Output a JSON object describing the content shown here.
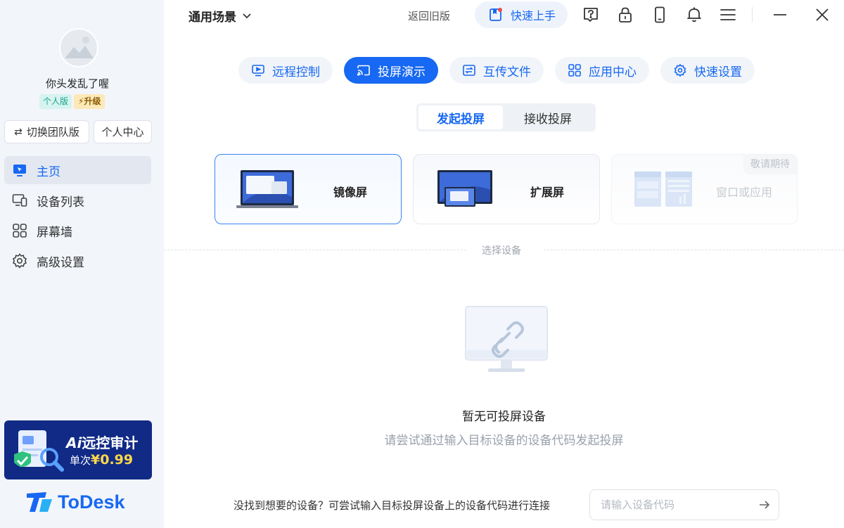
{
  "app": {
    "brand": "ToDesk"
  },
  "user": {
    "name": "你头发乱了喔",
    "edition": "个人版",
    "upgrade": "升级"
  },
  "sidebar": {
    "switch_team": "切换团队版",
    "personal_center": "个人中心",
    "items": [
      {
        "label": "主页",
        "icon": "home-monitor-icon",
        "active": true
      },
      {
        "label": "设备列表",
        "icon": "devices-icon",
        "active": false
      },
      {
        "label": "屏幕墙",
        "icon": "grid-icon",
        "active": false
      },
      {
        "label": "高级设置",
        "icon": "gear-icon",
        "active": false
      }
    ]
  },
  "promo": {
    "ai": "Ai",
    "title": "远控审计",
    "sub": "单次",
    "price": "¥0.99"
  },
  "topbar": {
    "scene": "通用场景",
    "back_old": "返回旧版",
    "quick_start": "快速上手",
    "icons": [
      "help-icon",
      "lock-icon",
      "phone-icon",
      "bell-icon",
      "menu-icon"
    ]
  },
  "main_tabs": [
    {
      "label": "远程控制",
      "icon": "remote-control-icon",
      "active": false
    },
    {
      "label": "投屏演示",
      "icon": "cast-icon",
      "active": true
    },
    {
      "label": "互传文件",
      "icon": "file-transfer-icon",
      "active": false
    },
    {
      "label": "应用中心",
      "icon": "apps-icon",
      "active": false
    },
    {
      "label": "快速设置",
      "icon": "settings-icon",
      "active": false
    }
  ],
  "sub_tabs": [
    {
      "label": "发起投屏",
      "active": true
    },
    {
      "label": "接收投屏",
      "active": false
    }
  ],
  "modes": [
    {
      "label": "镜像屏",
      "active": true,
      "enabled": true
    },
    {
      "label": "扩展屏",
      "active": false,
      "enabled": true
    },
    {
      "label": "窗口或应用",
      "active": false,
      "enabled": false,
      "badge": "敬请期待"
    }
  ],
  "select_device": "选择设备",
  "empty": {
    "title": "暂无可投屏设备",
    "sub": "请尝试通过输入目标设备的设备代码发起投屏"
  },
  "bottom": {
    "hint": "没找到想要的设备？可尝试输入目标投屏设备上的设备代码进行连接",
    "placeholder": "请输入设备代码",
    "value": ""
  },
  "colors": {
    "accent": "#1768f2",
    "sidebar_bg": "#f2f5fa",
    "promo_bg": "#102a85",
    "price": "#ffd64a"
  }
}
